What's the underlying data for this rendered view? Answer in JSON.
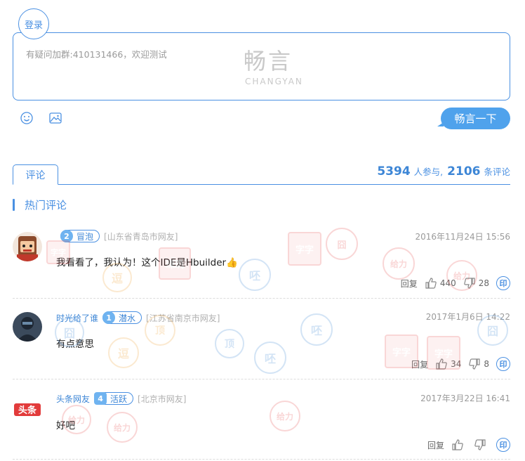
{
  "login": {
    "label": "登录"
  },
  "editor": {
    "placeholder": "有疑问加群:410131466，欢迎测试",
    "logo_cn": "畅言",
    "logo_en": "CHANGYAN"
  },
  "toolbar": {
    "emoji_icon": "smiley-icon",
    "image_icon": "image-icon"
  },
  "submit": {
    "label": "畅言一下"
  },
  "tabs": [
    {
      "label": "评论"
    }
  ],
  "stats": {
    "participants": "5394",
    "participants_label": "人参与,",
    "comments": "2106",
    "comments_label": "条评论"
  },
  "hot": {
    "title": "热门评论"
  },
  "comments": [
    {
      "user": "",
      "level": "2",
      "level_name": "冒泡",
      "location": "[山东省青岛市网友]",
      "time": "2016年11月24日 15:56",
      "content": "我看看了，我认为！这个IDE是Hbuilder👍",
      "reply": "回复",
      "likes": "440",
      "dislikes": "28",
      "share": "印"
    },
    {
      "user": "时光给了谁",
      "level": "1",
      "level_name": "潜水",
      "location": "[江苏省南京市网友]",
      "time": "2017年1月6日 14:22",
      "content": "有点意思",
      "reply": "回复",
      "likes": "34",
      "dislikes": "8",
      "share": "印"
    },
    {
      "user": "头条网友",
      "level": "4",
      "level_name": "活跃",
      "location": "[北京市网友]",
      "time": "2017年3月22日 16:41",
      "content": "好吧",
      "avatar_text": "头条",
      "reply": "回复",
      "likes": "",
      "dislikes": "",
      "share": "印"
    }
  ],
  "stamps": {
    "a": "字字",
    "b": "珠玑",
    "c": "逗",
    "d": "呸",
    "e": "给力",
    "f": "顶",
    "g": "囧"
  },
  "colors": {
    "accent": "#4a90e2",
    "button": "#4fa2ec",
    "link": "#3d86d6"
  }
}
